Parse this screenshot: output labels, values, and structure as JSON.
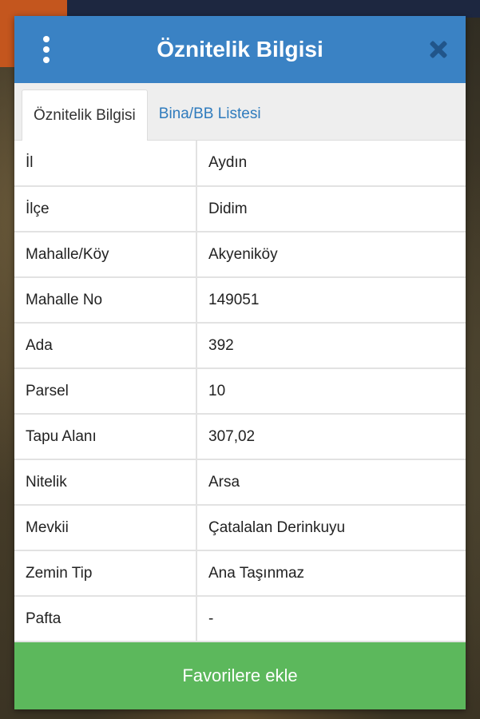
{
  "dialog": {
    "title": "Öznitelik Bilgisi",
    "menu_icon": "vertical-dots-icon",
    "close_icon": "close-icon"
  },
  "tabs": [
    {
      "label": "Öznitelik Bilgisi",
      "active": true
    },
    {
      "label": "Bina/BB Listesi",
      "active": false
    }
  ],
  "rows": [
    {
      "label": "İl",
      "value": "Aydın"
    },
    {
      "label": "İlçe",
      "value": "Didim"
    },
    {
      "label": "Mahalle/Köy",
      "value": "Akyeniköy"
    },
    {
      "label": "Mahalle No",
      "value": "149051"
    },
    {
      "label": "Ada",
      "value": "392"
    },
    {
      "label": "Parsel",
      "value": "10"
    },
    {
      "label": "Tapu Alanı",
      "value": "307,02"
    },
    {
      "label": "Nitelik",
      "value": "Arsa"
    },
    {
      "label": "Mevkii",
      "value": "Çatalalan Derinkuyu"
    },
    {
      "label": "Zemin Tip",
      "value": "Ana Taşınmaz"
    },
    {
      "label": "Pafta",
      "value": "-"
    }
  ],
  "footer": {
    "favorite_label": "Favorilere ekle"
  },
  "colors": {
    "header": "#3a82c4",
    "tab_link": "#2f7bbd",
    "favorite_button": "#5cb85c"
  }
}
